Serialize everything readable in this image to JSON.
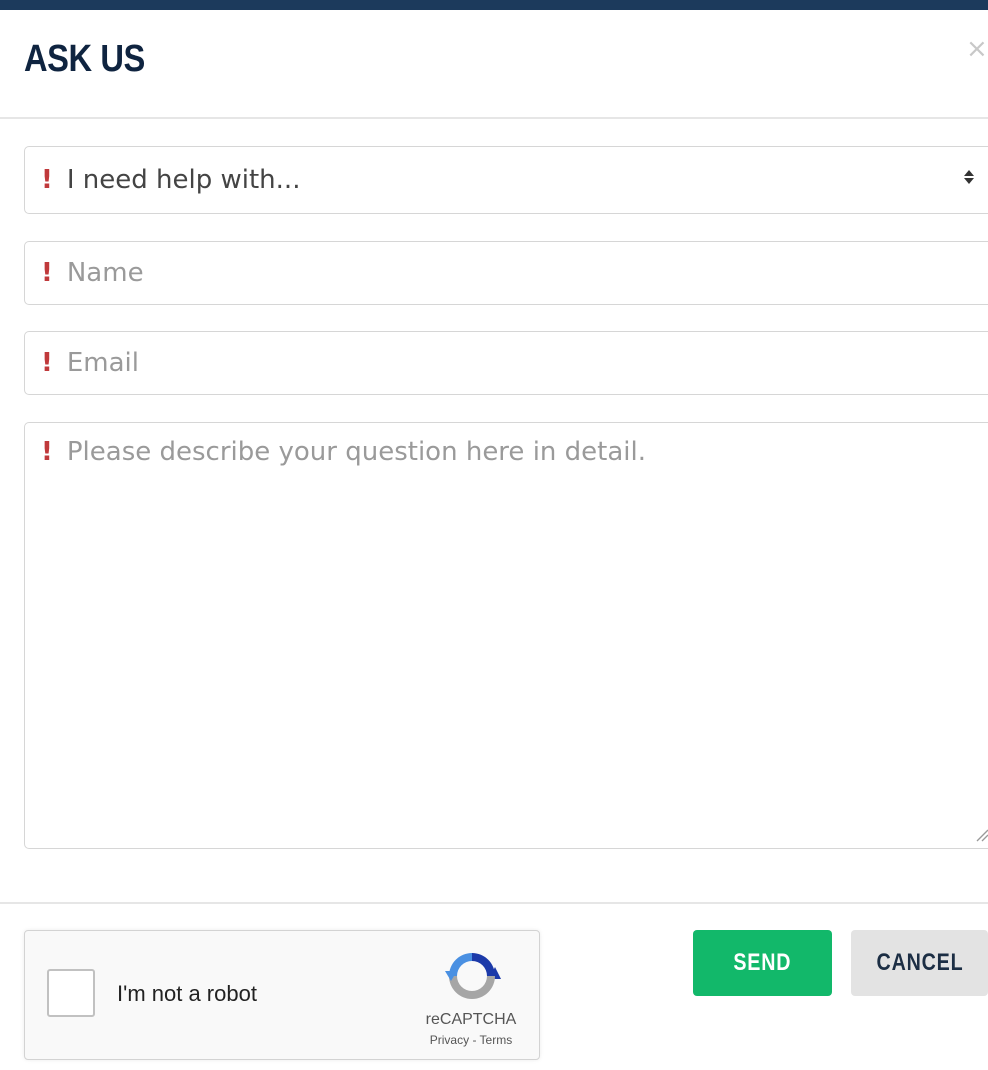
{
  "modal": {
    "title": "ASK US",
    "close_glyph": "×"
  },
  "form": {
    "help_select": {
      "selected": "I need help with...",
      "arrows": "▲▼"
    },
    "name": {
      "placeholder": "Name"
    },
    "email": {
      "placeholder": "Email"
    },
    "question": {
      "placeholder": "Please describe your question here in detail."
    },
    "required_marker": "!"
  },
  "recaptcha": {
    "label": "I'm not a robot",
    "brand": "reCAPTCHA",
    "links": "Privacy - Terms"
  },
  "actions": {
    "send_label": "SEND",
    "cancel_label": "CANCEL"
  },
  "colors": {
    "brand_navy": "#0f2440",
    "required_red": "#c0393b",
    "send_green": "#12b86a",
    "cancel_gray": "#e3e3e3"
  },
  "icons": {
    "close": "close-icon",
    "select_arrows": "sort-arrows-icon",
    "resize": "resize-grip-icon",
    "recaptcha": "recaptcha-logo-icon"
  }
}
